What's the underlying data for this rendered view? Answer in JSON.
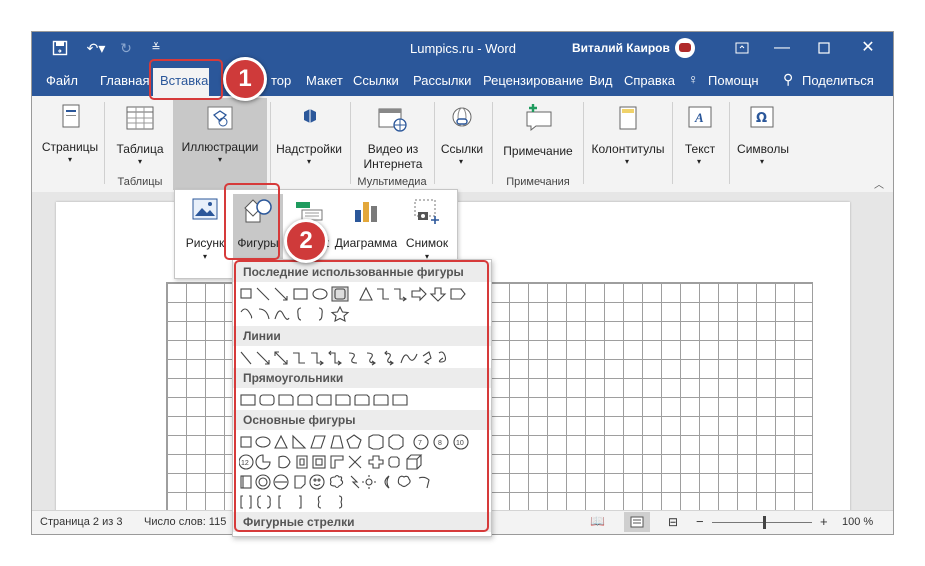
{
  "titlebar": {
    "title": "Lumpics.ru  -  Word",
    "user": "Виталий Каиров"
  },
  "menu": {
    "items": [
      "Файл",
      "Главная",
      "Вставка",
      "тор",
      "Макет",
      "Ссылки",
      "Рассылки",
      "Рецензирование",
      "Вид",
      "Справка"
    ],
    "tell_me": "Помощн",
    "share": "Поделиться"
  },
  "ribbon": {
    "pages": "Страницы",
    "table": "Таблица",
    "tables_group": "Таблицы",
    "illustrations": "Иллюстрации",
    "addins": "Надстройки",
    "video_line1": "Видео из",
    "video_line2": "Интернета",
    "multimedia_group": "Мультимедиа",
    "links": "Ссылки",
    "comment": "Примечание",
    "comments_group": "Примечания",
    "header_footer": "Колонтитулы",
    "text": "Текст",
    "symbols": "Символы"
  },
  "illustrations_menu": {
    "picture": "Рисунк",
    "shapes": "Фигуры",
    "smartart": "rt",
    "chart": "Диаграмма",
    "screenshot": "Снимок"
  },
  "shapes_menu": {
    "recent": "Последние использованные фигуры",
    "lines": "Линии",
    "rectangles": "Прямоугольники",
    "basic": "Основные фигуры",
    "arrows": "Фигурные стрелки"
  },
  "status": {
    "page": "Страница 2 из 3",
    "words": "Число слов: 115",
    "zoom": "100 %",
    "minus": "−",
    "plus": "+"
  },
  "badges": {
    "one": "1",
    "two": "2"
  },
  "colors": {
    "accent": "#2b579a",
    "highlight": "#d63a3a"
  }
}
